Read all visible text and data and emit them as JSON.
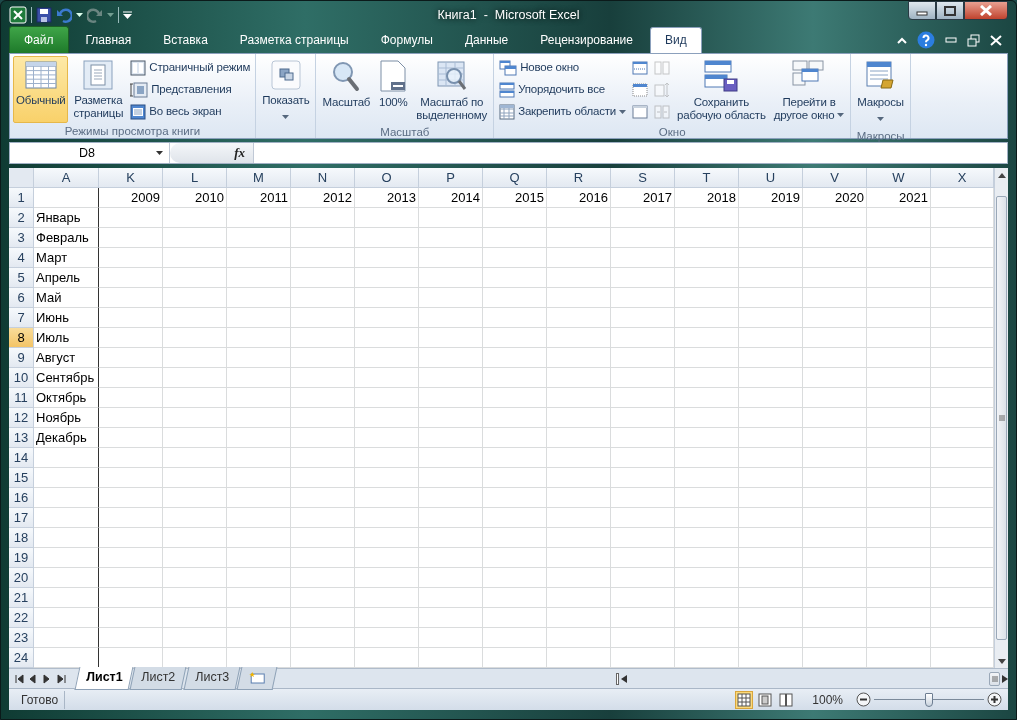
{
  "window": {
    "title": "Книга1  -  Microsoft Excel"
  },
  "ribbon": {
    "tabs": [
      {
        "label": "Файл",
        "kind": "file",
        "selected": false
      },
      {
        "label": "Главная",
        "kind": "tab",
        "selected": false
      },
      {
        "label": "Вставка",
        "kind": "tab",
        "selected": false
      },
      {
        "label": "Разметка страницы",
        "kind": "tab",
        "selected": false
      },
      {
        "label": "Формулы",
        "kind": "tab",
        "selected": false
      },
      {
        "label": "Данные",
        "kind": "tab",
        "selected": false
      },
      {
        "label": "Рецензирование",
        "kind": "tab",
        "selected": false
      },
      {
        "label": "Вид",
        "kind": "tab",
        "selected": true
      }
    ],
    "groups": [
      {
        "label": "Режимы просмотра книги",
        "items": [
          {
            "kind": "large",
            "label": "Обычный",
            "selected": true
          },
          {
            "kind": "large",
            "label": "Разметка\nстраницы",
            "selected": false
          },
          {
            "kind": "small",
            "label": "Страничный режим"
          },
          {
            "kind": "small",
            "label": "Представления"
          },
          {
            "kind": "small",
            "label": "Во весь экран"
          }
        ]
      },
      {
        "items": [
          {
            "kind": "large",
            "label": "Показать",
            "selected": false,
            "dropdown": true
          }
        ]
      },
      {
        "label": "Масштаб",
        "items": [
          {
            "kind": "large",
            "label": "Масштаб",
            "selected": false
          },
          {
            "kind": "large",
            "label": "100%",
            "selected": false
          },
          {
            "kind": "large",
            "label": "Масштаб по\nвыделенному",
            "selected": false
          }
        ]
      },
      {
        "label": "Окно",
        "items": [
          {
            "kind": "small",
            "label": "Новое окно"
          },
          {
            "kind": "small",
            "label": "Упорядочить все"
          },
          {
            "kind": "small",
            "label": "Закрепить области",
            "dropdown": true
          },
          {
            "kind": "icon",
            "disabled": false
          },
          {
            "kind": "icon",
            "disabled": false
          },
          {
            "kind": "icon",
            "disabled": false
          },
          {
            "kind": "icon",
            "disabled": true
          },
          {
            "kind": "icon",
            "disabled": true
          },
          {
            "kind": "icon",
            "disabled": true
          },
          {
            "kind": "large",
            "label": "Сохранить\nрабочую область",
            "selected": false
          },
          {
            "kind": "large",
            "label": "Перейти в\nдругое окно",
            "selected": false,
            "dropdown": true
          }
        ]
      },
      {
        "label": "Макросы",
        "items": [
          {
            "kind": "large",
            "label": "Макросы",
            "selected": false,
            "dropdown": true
          }
        ]
      }
    ]
  },
  "formula_bar": {
    "name_box": "D8",
    "function_label": "fx"
  },
  "grid": {
    "columns": [
      {
        "label": "A",
        "selected": false
      },
      {
        "label": "K",
        "selected": false
      },
      {
        "label": "L",
        "selected": false
      },
      {
        "label": "M",
        "selected": false
      },
      {
        "label": "N",
        "selected": false
      },
      {
        "label": "O",
        "selected": false
      },
      {
        "label": "P",
        "selected": false
      },
      {
        "label": "Q",
        "selected": false
      },
      {
        "label": "R",
        "selected": false
      },
      {
        "label": "S",
        "selected": false
      },
      {
        "label": "T",
        "selected": false
      },
      {
        "label": "U",
        "selected": false
      },
      {
        "label": "V",
        "selected": false
      },
      {
        "label": "W",
        "selected": false
      },
      {
        "label": "X",
        "selected": false
      }
    ],
    "rows": [
      {
        "number": "1",
        "selected": false,
        "values": [
          "2009",
          "2010",
          "2011",
          "2012",
          "2013",
          "2014",
          "2015",
          "2016",
          "2017",
          "2018",
          "2019",
          "2020",
          "2021"
        ]
      },
      {
        "number": "2",
        "selected": false,
        "a": "Январь"
      },
      {
        "number": "3",
        "selected": false,
        "a": "Февраль"
      },
      {
        "number": "4",
        "selected": false,
        "a": "Март"
      },
      {
        "number": "5",
        "selected": false,
        "a": "Апрель"
      },
      {
        "number": "6",
        "selected": false,
        "a": "Май"
      },
      {
        "number": "7",
        "selected": false,
        "a": "Июнь"
      },
      {
        "number": "8",
        "selected": true,
        "a": "Июль"
      },
      {
        "number": "9",
        "selected": false,
        "a": "Август"
      },
      {
        "number": "10",
        "selected": false,
        "a": "Сентябрь"
      },
      {
        "number": "11",
        "selected": false,
        "a": "Октябрь"
      },
      {
        "number": "12",
        "selected": false,
        "a": "Ноябрь"
      },
      {
        "number": "13",
        "selected": false,
        "a": "Декабрь"
      },
      {
        "number": "14",
        "selected": false
      },
      {
        "number": "15",
        "selected": false
      },
      {
        "number": "16",
        "selected": false
      },
      {
        "number": "17",
        "selected": false
      },
      {
        "number": "18",
        "selected": false
      },
      {
        "number": "19",
        "selected": false
      },
      {
        "number": "20",
        "selected": false
      },
      {
        "number": "21",
        "selected": false
      },
      {
        "number": "22",
        "selected": false
      },
      {
        "number": "23",
        "selected": false
      },
      {
        "number": "24",
        "selected": false
      }
    ]
  },
  "sheet_tabs": [
    {
      "label": "Лист1",
      "selected": true
    },
    {
      "label": "Лист2",
      "selected": false
    },
    {
      "label": "Лист3",
      "selected": false
    }
  ],
  "status_bar": {
    "status": "Готово",
    "view_buttons": [
      {
        "selected": true
      },
      {
        "selected": false
      },
      {
        "selected": false
      }
    ],
    "zoom": "100%",
    "zoom_slider": {
      "level": 0.5
    }
  }
}
